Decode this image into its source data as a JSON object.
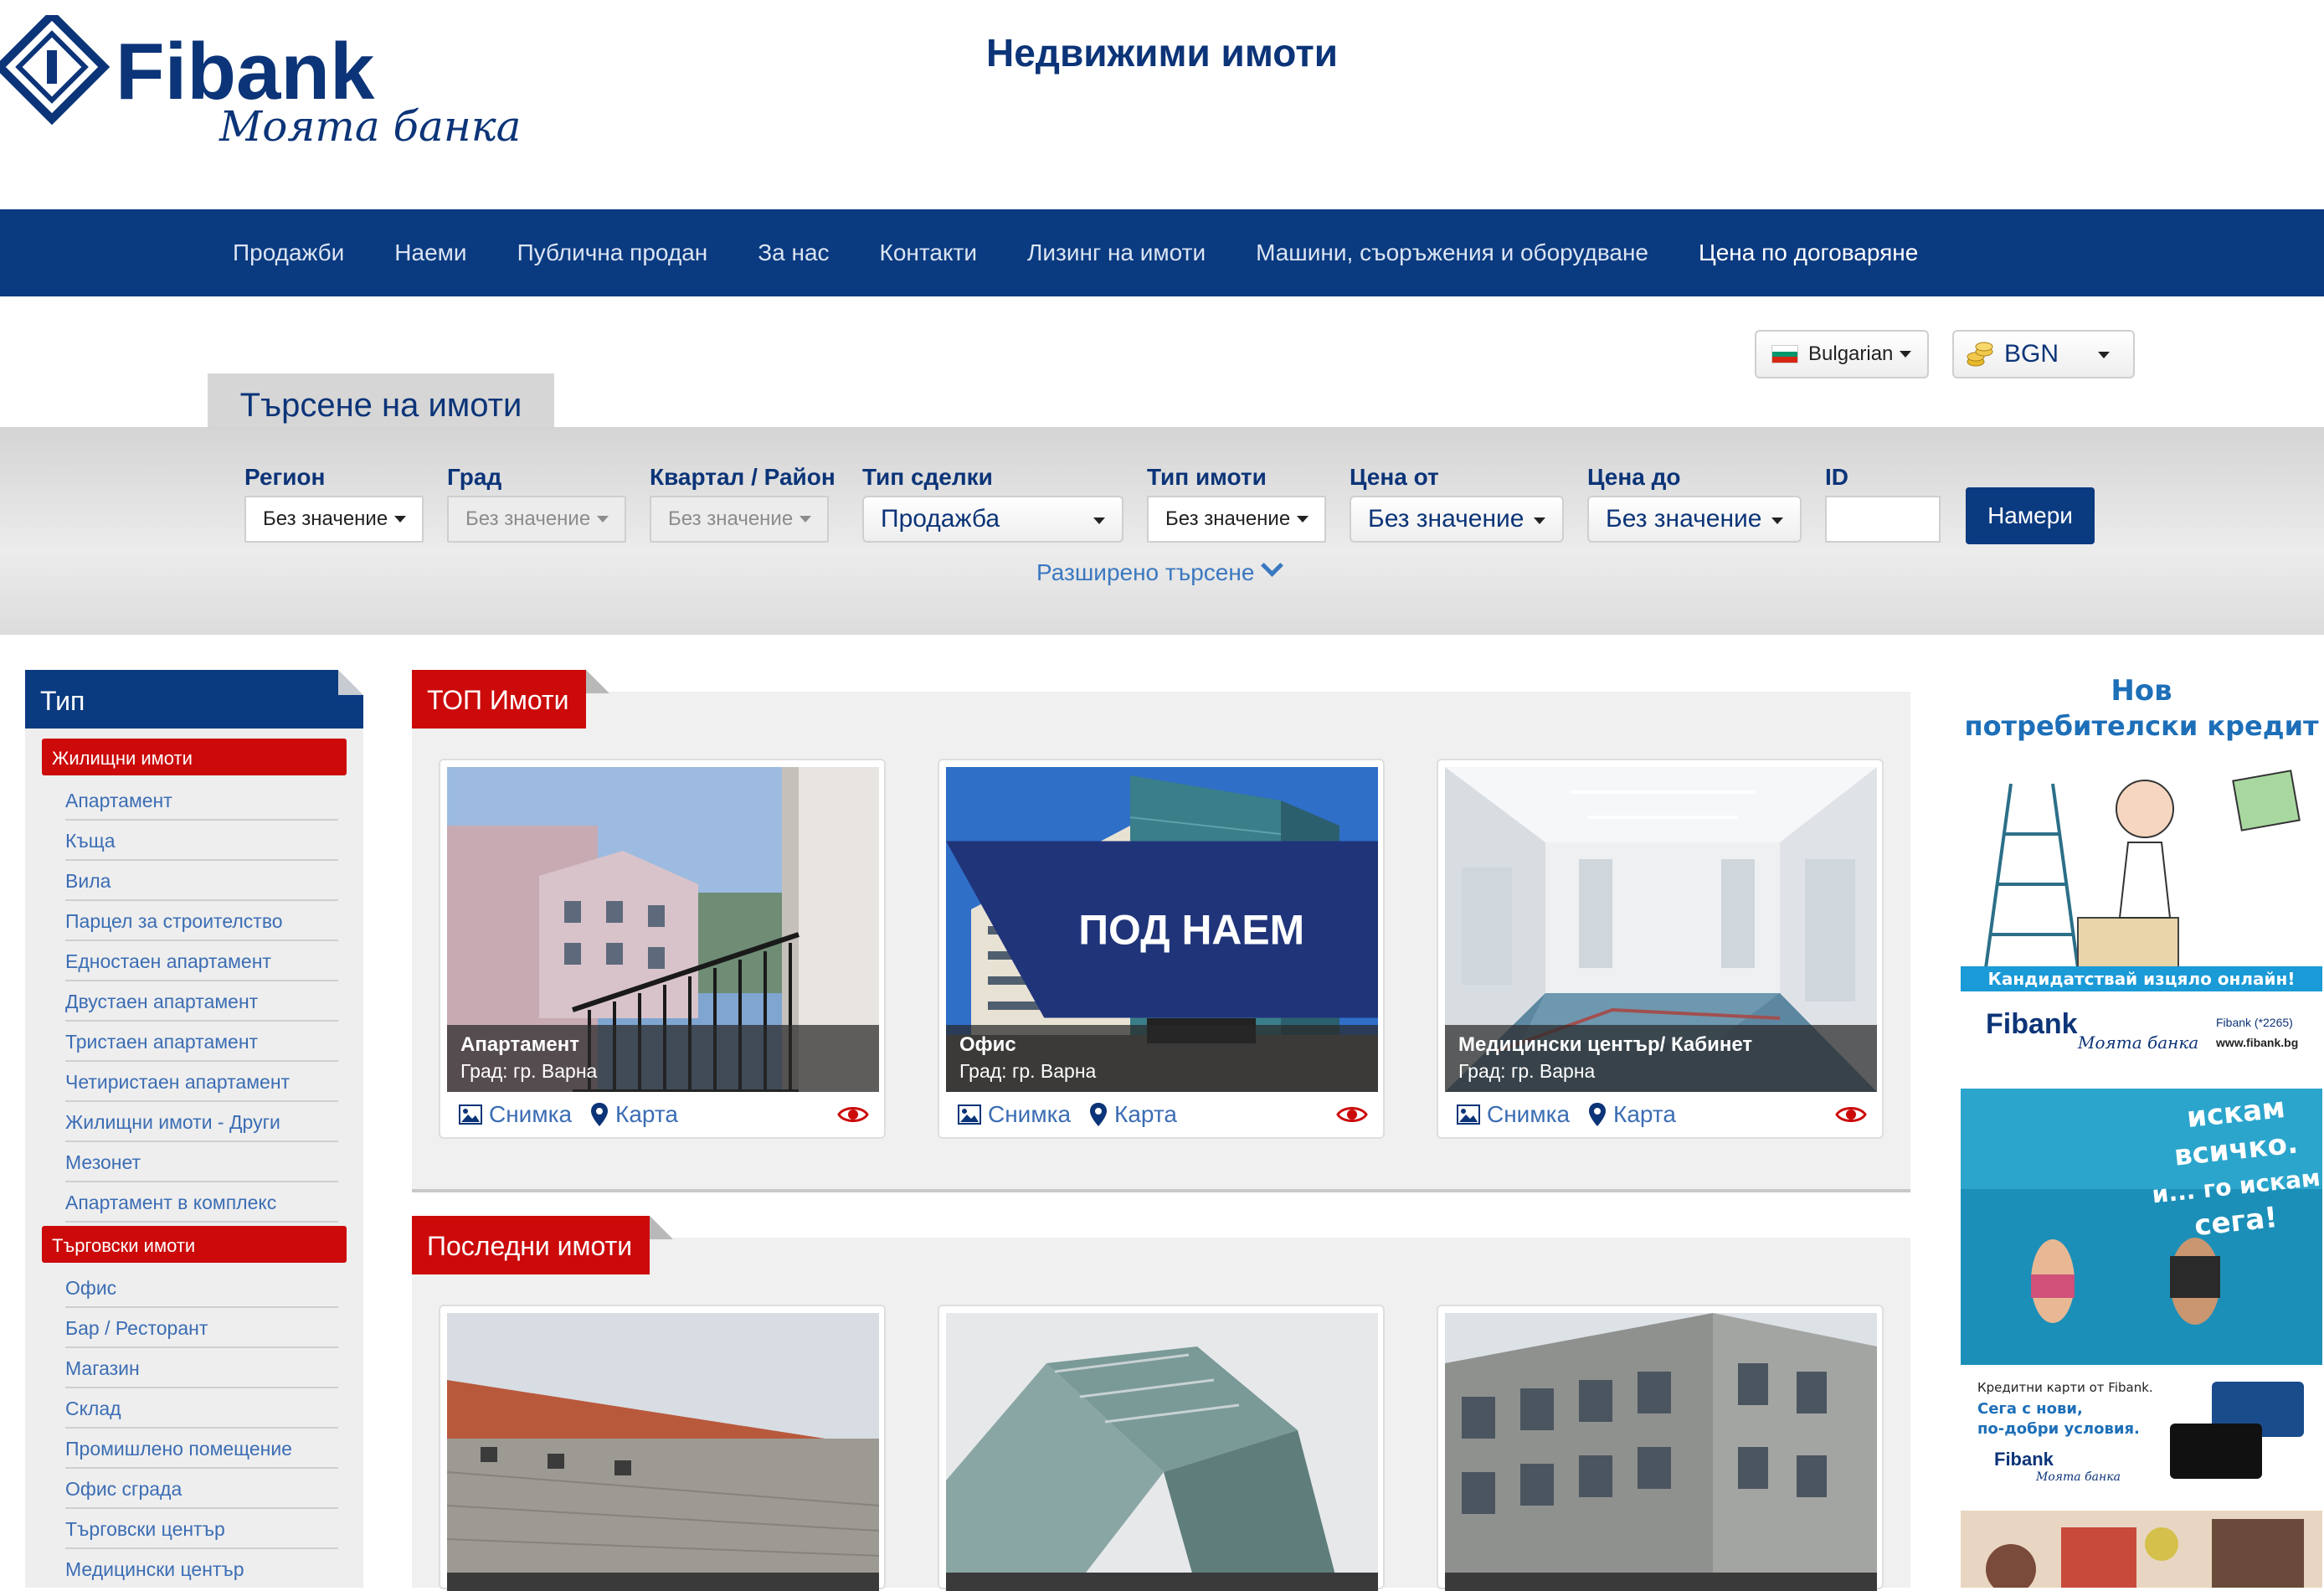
{
  "header": {
    "site_title": "Недвижими имоти",
    "logo": {
      "brand": "Fibank",
      "tagline": "Моята банка"
    }
  },
  "nav": {
    "items": [
      {
        "label": "Продажби"
      },
      {
        "label": "Наеми"
      },
      {
        "label": "Публична продан"
      },
      {
        "label": "За нас"
      },
      {
        "label": "Контакти"
      },
      {
        "label": "Лизинг на имоти"
      },
      {
        "label": "Машини, съоръжения и оборудване"
      },
      {
        "label": "Цена по договаряне"
      }
    ],
    "active_index": 7
  },
  "language": {
    "value": "Bulgarian"
  },
  "currency": {
    "value": "BGN"
  },
  "search": {
    "tab_label": "Търсене на имоти",
    "fields": [
      {
        "label": "Регион",
        "value": "Без значение"
      },
      {
        "label": "Град",
        "value": "Без значение"
      },
      {
        "label": "Квартал / Район",
        "value": "Без значение"
      },
      {
        "label": "Тип сделки",
        "value": "Продажба"
      },
      {
        "label": "Тип имоти",
        "value": "Без значение"
      },
      {
        "label": "Цена от",
        "value": "Без значение"
      },
      {
        "label": "Цена до",
        "value": "Без значение"
      },
      {
        "label": "ID",
        "value": ""
      }
    ],
    "submit_label": "Намери",
    "advanced_label": "Разширено търсене"
  },
  "sidebar": {
    "title": "Тип",
    "groups": [
      {
        "label": "Жилищни имоти",
        "items": [
          "Апартамент",
          "Къща",
          "Вила",
          "Парцел за строителство",
          "Едностаен апартамент",
          "Двустаен апартамент",
          "Тристаен апартамент",
          "Четиристаен апартамент",
          "Жилищни имоти - Други",
          "Мезонет",
          "Апартамент в комплекс"
        ]
      },
      {
        "label": "Търговски имоти",
        "items": [
          "Офис",
          "Бар / Ресторант",
          "Магазин",
          "Склад",
          "Промишлено помещение",
          "Офис сграда",
          "Търговски център",
          "Медицински център"
        ]
      }
    ]
  },
  "top_section": {
    "title": "ТОП Имоти",
    "cards": [
      {
        "title": "Апартамент",
        "city": "Град: гр. Варна",
        "ribbon": ""
      },
      {
        "title": "Офис",
        "city": "Град: гр. Варна",
        "ribbon": "ПОД НАЕМ"
      },
      {
        "title": "Медицински център/ Кабинет",
        "city": "Град: гр. Варна",
        "ribbon": ""
      }
    ],
    "photo_label": "Снимка",
    "map_label": "Карта"
  },
  "latest_section": {
    "title": "Последни имоти"
  },
  "ads": [
    {
      "headline": "Нов потребителски кредит",
      "cta": "Кандидатствай изцяло онлайн!",
      "brand": "Fibank",
      "tagline": "Моята банка",
      "phone": "Fibank (*2265)",
      "url": "www.fibank.bg"
    },
    {
      "headline": "искам всичко. и... го искам сега!",
      "body": "Кредитни карти от Fibank. Сега с нови, по-добри условия.",
      "brand": "Fibank",
      "tagline": "Моята банка"
    }
  ],
  "colors": {
    "brand_blue": "#0a3a80",
    "accent_red": "#cc0a0a",
    "link_blue": "#3b6db4"
  }
}
